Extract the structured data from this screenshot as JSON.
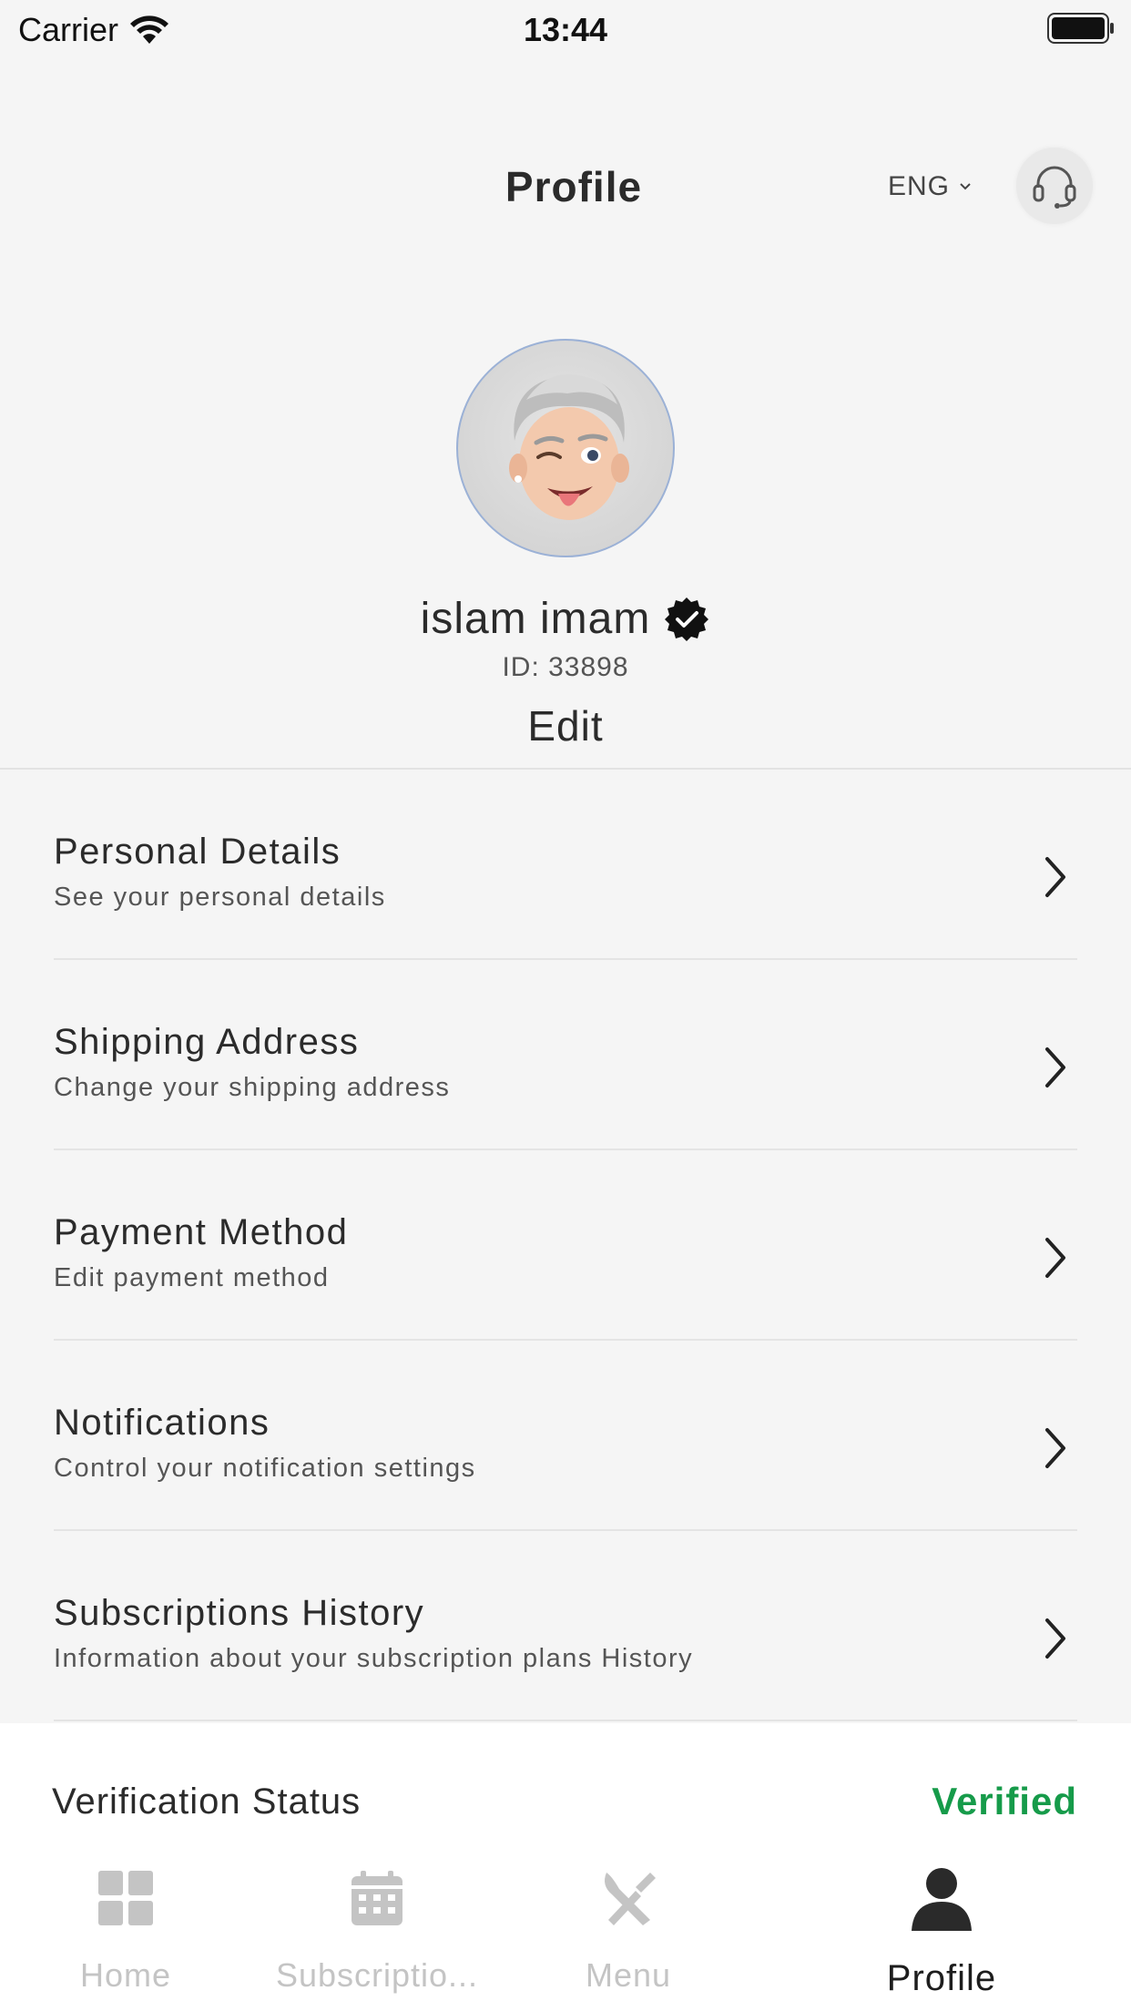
{
  "status_bar": {
    "carrier": "Carrier",
    "time": "13:44"
  },
  "header": {
    "title": "Profile",
    "language": "ENG"
  },
  "profile": {
    "name": "islam imam",
    "id_text": "ID: 33898",
    "edit_label": "Edit"
  },
  "menu": [
    {
      "title": "Personal Details",
      "subtitle": "See your personal details"
    },
    {
      "title": "Shipping Address",
      "subtitle": "Change your shipping address"
    },
    {
      "title": "Payment Method",
      "subtitle": "Edit payment method"
    },
    {
      "title": "Notifications",
      "subtitle": "Control your notification settings"
    },
    {
      "title": "Subscriptions History",
      "subtitle": "Information about your subscription plans History"
    }
  ],
  "verification": {
    "label": "Verification Status",
    "value": "Verified",
    "value_color": "#169b4a"
  },
  "tabs": [
    {
      "label": "Home",
      "icon": "grid-icon"
    },
    {
      "label": "Subscriptio...",
      "icon": "calendar-icon"
    },
    {
      "label": "Menu",
      "icon": "utensils-icon"
    },
    {
      "label": "Profile",
      "icon": "person-icon",
      "active": true
    }
  ]
}
